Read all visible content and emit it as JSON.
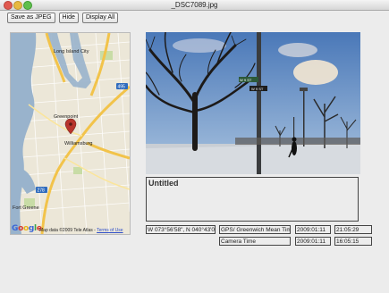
{
  "window": {
    "title": "_DSC7089.jpg"
  },
  "toolbar": {
    "save_label": "Save as JPEG",
    "hide_label": "Hide",
    "display_all_label": "Display All"
  },
  "map": {
    "labels": [
      "Long Island City",
      "Greenpoint",
      "Williamsburg",
      "Fort Greene"
    ],
    "highway_shields": [
      "495",
      "278"
    ],
    "logo": "Google",
    "credit": "Map data ©2009 Tele Atlas -",
    "terms_link": "Terms of Use"
  },
  "photo": {
    "street_sign_1": "W 9 ST",
    "street_sign_2": "W 9 ST"
  },
  "metadata": {
    "title": "Untitled",
    "coordinates": "W 073°56'58\", N 040°43'08\"",
    "gps_label": "GPS/ Greenwich Mean Time",
    "gps_date": "2009:01:11",
    "gps_time": "21:05:29",
    "camera_label": "Camera Time",
    "camera_date": "2009:01:11",
    "camera_time": "16:05:15"
  }
}
